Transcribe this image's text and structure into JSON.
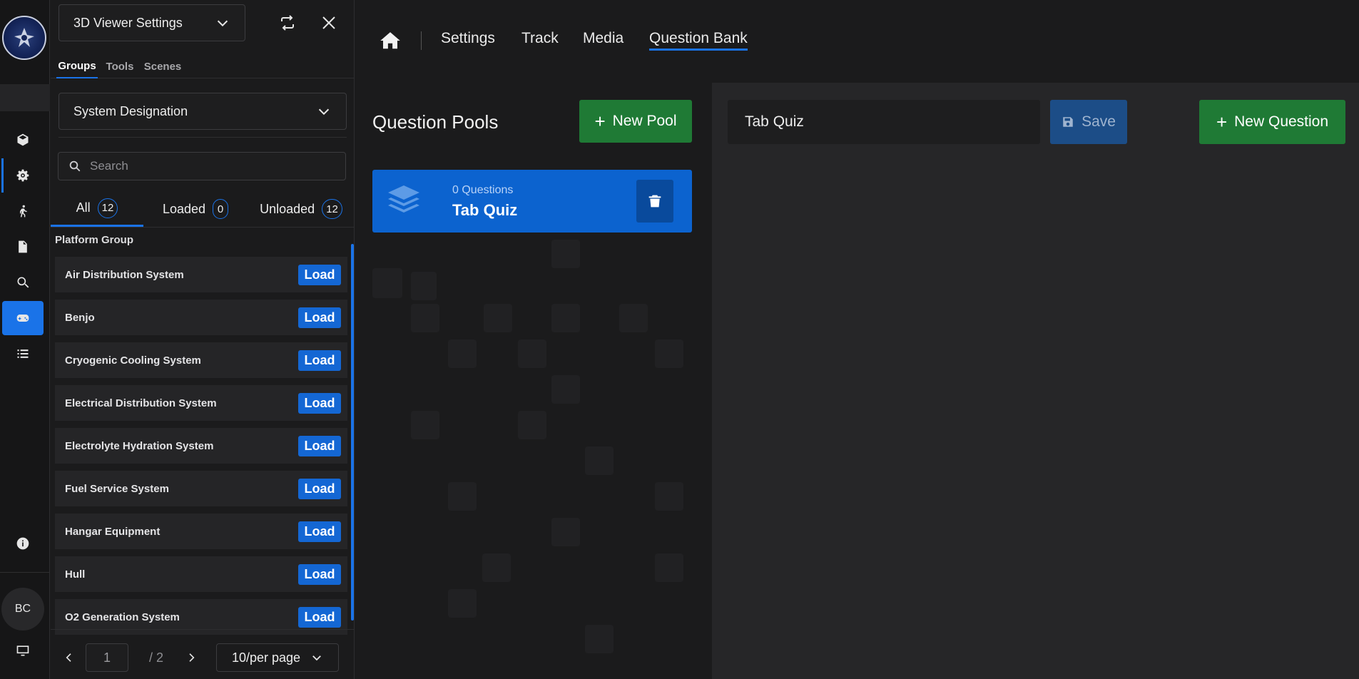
{
  "rail": {
    "items": [
      "cube-icon",
      "gear-icon",
      "walk-icon",
      "document-icon",
      "search-icon",
      "gamepad-icon",
      "list-icon"
    ],
    "active": "gamepad-icon",
    "avatar_initials": "BC"
  },
  "panel": {
    "viewer_select": "3D Viewer Settings",
    "tabs": [
      "Groups",
      "Tools",
      "Scenes"
    ],
    "active_tab": "Groups",
    "designation_select": "System Designation",
    "search_placeholder": "Search",
    "filters": [
      {
        "label": "All",
        "count": "12"
      },
      {
        "label": "Loaded",
        "count": "0"
      },
      {
        "label": "Unloaded",
        "count": "12"
      }
    ],
    "group_heading": "Platform Group",
    "load_label": "Load",
    "items": [
      "Air Distribution System",
      "Benjo",
      "Cryogenic Cooling System",
      "Electrical Distribution System",
      "Electrolyte Hydration System",
      "Fuel Service System",
      "Hangar Equipment",
      "Hull",
      "O2 Generation System"
    ],
    "pagination": {
      "page": "1",
      "total": "/ 2",
      "per_page": "10/per page"
    }
  },
  "nav": {
    "links": [
      "Settings",
      "Track",
      "Media",
      "Question Bank"
    ],
    "active": "Question Bank"
  },
  "pools": {
    "title": "Question Pools",
    "new_pool_label": "New Pool",
    "items": [
      {
        "count_label": "0 Questions",
        "name": "Tab Quiz"
      }
    ]
  },
  "editor": {
    "pool_name_value": "Tab Quiz",
    "save_label": "Save",
    "new_question_label": "New Question"
  },
  "colors": {
    "accent": "#1a73e8",
    "green": "#1f7a35",
    "card_blue": "#0c63cf"
  }
}
